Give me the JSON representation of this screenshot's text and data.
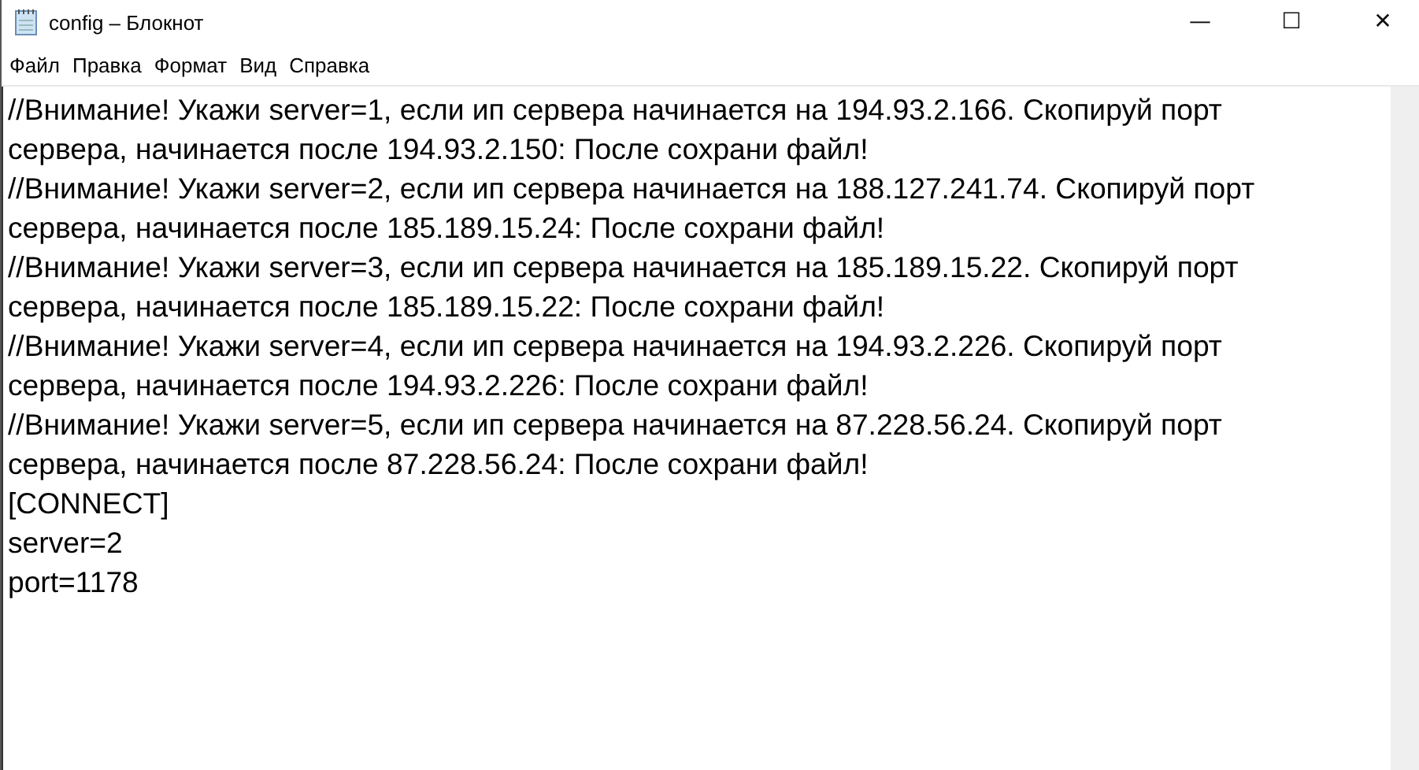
{
  "window": {
    "title": "config – Блокнот",
    "controls": [
      "—",
      "☐",
      "✕"
    ]
  },
  "menu": [
    "Файл",
    "Правка",
    "Формат",
    "Вид",
    "Справка"
  ],
  "editor": {
    "lines": [
      "//Внимание! Укажи server=1, если ип сервера начинается на 194.93.2.166. Скопируй порт",
      "сервера, начинается после 194.93.2.150: После сохрани файл!",
      "//Внимание! Укажи server=2, если ип сервера начинается на 188.127.241.74. Скопируй порт",
      "сервера, начинается после 185.189.15.24: После сохрани файл!",
      "//Внимание! Укажи server=3, если ип сервера начинается на 185.189.15.22. Скопируй порт",
      "сервера, начинается после 185.189.15.22: После сохрани файл!",
      "//Внимание! Укажи server=4, если ип сервера начинается на 194.93.2.226. Скопируй порт",
      "сервера, начинается после 194.93.2.226: После сохрани файл!",
      "//Внимание! Укажи server=5, если ип сервера начинается на 87.228.56.24. Скопируй порт",
      "сервера, начинается после 87.228.56.24: После сохрани файл!",
      "[CONNECT]",
      "server=2",
      "port=1178"
    ]
  }
}
